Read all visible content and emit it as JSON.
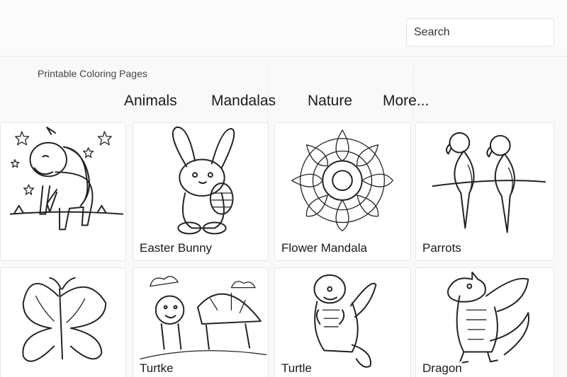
{
  "header": {
    "search": {
      "placeholder": "Search"
    }
  },
  "site": {
    "title": "Printable Coloring Pages"
  },
  "nav": [
    "Animals",
    "Mandalas",
    "Nature",
    "More..."
  ],
  "cards": [
    {
      "label": "",
      "icon": "unicorn-icon"
    },
    {
      "label": "Easter Bunny",
      "icon": "bunny-icon"
    },
    {
      "label": "Flower Mandala",
      "icon": "mandala-icon"
    },
    {
      "label": "Parrots",
      "icon": "parrots-icon"
    },
    {
      "label": "",
      "icon": "butterfly-icon"
    },
    {
      "label": "Turtke",
      "icon": "turtle-icon"
    },
    {
      "label": "Turtle",
      "icon": "baby-dragon-icon"
    },
    {
      "label": "Dragon",
      "icon": "dragon-icon"
    }
  ]
}
